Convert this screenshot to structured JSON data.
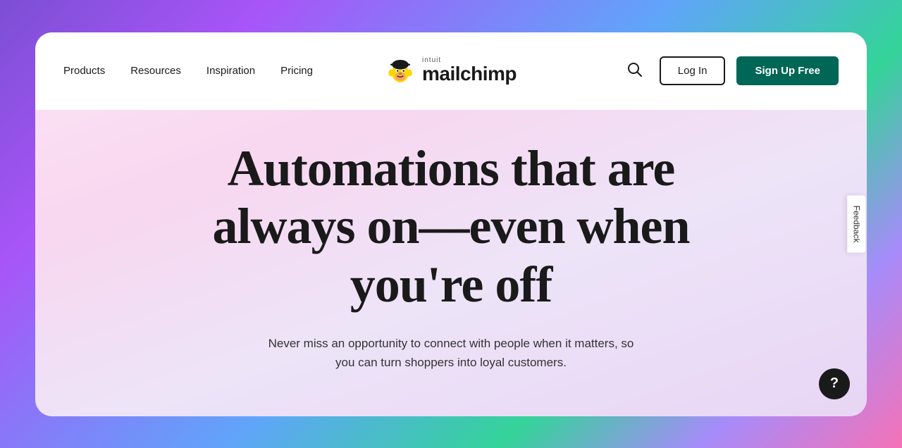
{
  "page": {
    "background_gradient": "linear-gradient(135deg, #7b4fd4 0%, #a855f7 20%, #60a5fa 50%, #34d399 70%, #a78bfa 85%, #f472b6 100%)"
  },
  "navbar": {
    "nav_items": [
      {
        "label": "Products",
        "id": "products"
      },
      {
        "label": "Resources",
        "id": "resources"
      },
      {
        "label": "Inspiration",
        "id": "inspiration"
      },
      {
        "label": "Pricing",
        "id": "pricing"
      }
    ],
    "logo": {
      "intuit_label": "intuit",
      "brand_label": "mailchimp"
    },
    "login_label": "Log In",
    "signup_label": "Sign Up Free"
  },
  "hero": {
    "title": "Automations that are always on—even when you're off",
    "subtitle": "Never miss an opportunity to connect with people when it matters, so you can turn shoppers into loyal customers."
  },
  "feedback": {
    "label": "Feedback"
  },
  "help": {
    "label": "?"
  }
}
